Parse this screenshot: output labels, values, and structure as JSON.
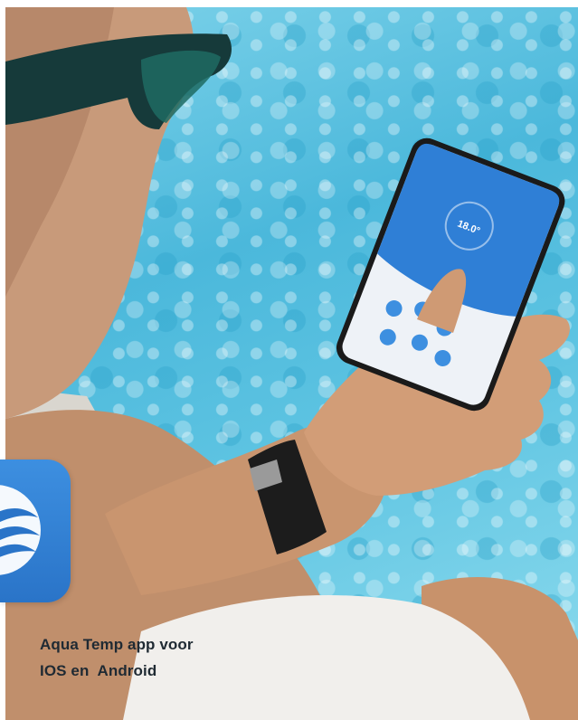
{
  "caption": {
    "line1": "Aqua Temp app voor",
    "line2": "IOS en  Android"
  },
  "phone": {
    "temperature": "18.0°"
  },
  "icons": {
    "app_icon": "aqua-temp-wave-icon"
  },
  "colors": {
    "pool_water": "#4bb8db",
    "app_blue": "#2f7fd6",
    "caption_text": "#1f2a33"
  }
}
